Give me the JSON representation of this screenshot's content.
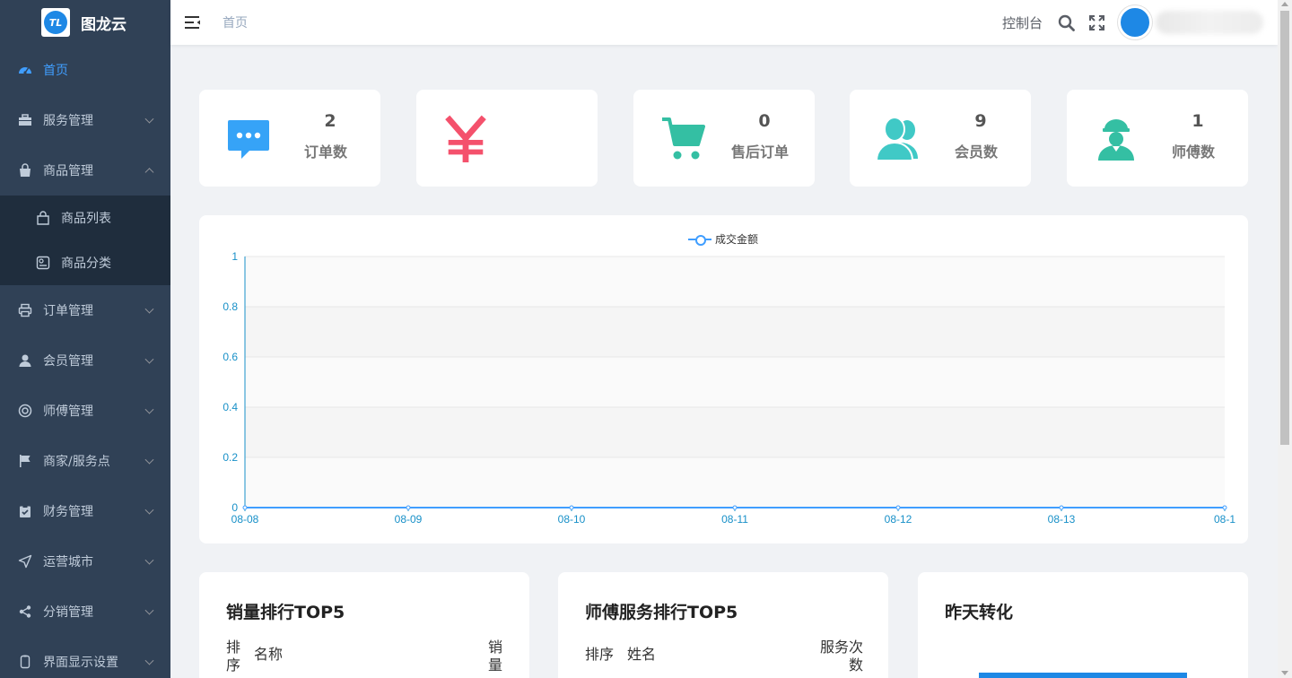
{
  "app": {
    "name": "图龙云",
    "logo_text": "TL"
  },
  "sidebar": {
    "items": [
      {
        "label": "首页",
        "icon": "dashboard-icon"
      },
      {
        "label": "服务管理",
        "icon": "briefcase-icon"
      },
      {
        "label": "商品管理",
        "icon": "bag-icon"
      },
      {
        "label": "订单管理",
        "icon": "printer-icon"
      },
      {
        "label": "会员管理",
        "icon": "user-icon"
      },
      {
        "label": "师傅管理",
        "icon": "lifebuoy-icon"
      },
      {
        "label": "商家/服务点",
        "icon": "flag-icon"
      },
      {
        "label": "财务管理",
        "icon": "checklist-icon"
      },
      {
        "label": "运营城市",
        "icon": "location-arrow-icon"
      },
      {
        "label": "分销管理",
        "icon": "share-icon"
      },
      {
        "label": "界面显示设置",
        "icon": "phone-icon"
      }
    ],
    "submenu": [
      {
        "label": "商品列表",
        "icon": "shopping-bag-icon"
      },
      {
        "label": "商品分类",
        "icon": "category-icon"
      }
    ]
  },
  "header": {
    "breadcrumb": "首页",
    "console": "控制台"
  },
  "stats": [
    {
      "value": "2",
      "label": "订单数",
      "icon": "chat-bubble-icon",
      "color": "#36a3f7"
    },
    {
      "value": "",
      "label": "",
      "icon": "yen-icon",
      "color": "#f4516c"
    },
    {
      "value": "0",
      "label": "售后订单",
      "icon": "cart-icon",
      "color": "#34bfa3"
    },
    {
      "value": "9",
      "label": "会员数",
      "icon": "users-icon",
      "color": "#40c9c6"
    },
    {
      "value": "1",
      "label": "师傅数",
      "icon": "worker-icon",
      "color": "#34bfa3"
    }
  ],
  "chart_data": {
    "type": "line",
    "x": [
      "08-08",
      "08-09",
      "08-10",
      "08-11",
      "08-12",
      "08-13",
      "08-1"
    ],
    "series": [
      {
        "name": "成交金额",
        "values": [
          0,
          0,
          0,
          0,
          0,
          0,
          0
        ]
      }
    ],
    "yticks": [
      "0",
      "0.2",
      "0.4",
      "0.6",
      "0.8",
      "1"
    ],
    "ylim": [
      0,
      1
    ],
    "grid": true,
    "legend": "top-center",
    "color": "#409eff",
    "axis_color": "#1890c8"
  },
  "panels": {
    "sales_top": {
      "title": "销量排行TOP5",
      "col_rank": "排序",
      "col_name": "名称",
      "col_sales": "销量"
    },
    "master_top": {
      "title": "师傅服务排行TOP5",
      "col_rank": "排序",
      "col_name": "姓名",
      "col_count": "服务次数"
    },
    "conversion": {
      "title": "昨天转化"
    }
  }
}
